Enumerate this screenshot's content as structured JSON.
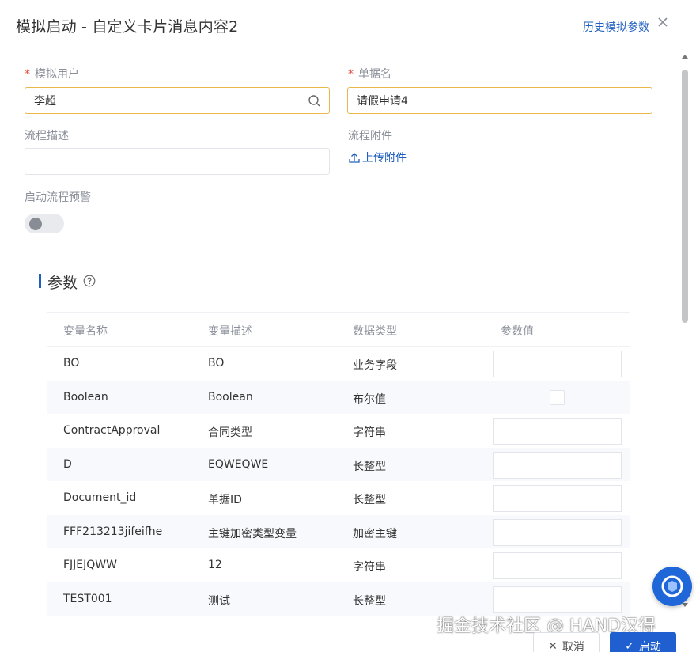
{
  "header": {
    "title": "模拟启动 - 自定义卡片消息内容2",
    "history_link": "历史模拟参数"
  },
  "form": {
    "user": {
      "label": "模拟用户",
      "value": "李超",
      "required": true
    },
    "doc_name": {
      "label": "单据名",
      "value": "请假申请4",
      "required": true
    },
    "flow_desc": {
      "label": "流程描述",
      "value": ""
    },
    "attachments": {
      "label": "流程附件",
      "upload_label": "上传附件"
    },
    "warning": {
      "label": "启动流程预警",
      "enabled": false
    }
  },
  "params": {
    "title": "参数",
    "columns": [
      "变量名称",
      "变量描述",
      "数据类型",
      "参数值"
    ],
    "rows": [
      {
        "name": "BO",
        "desc": "BO",
        "type": "业务字段",
        "input": "text"
      },
      {
        "name": "Boolean",
        "desc": "Boolean",
        "type": "布尔值",
        "input": "checkbox"
      },
      {
        "name": "ContractApproval",
        "desc": "合同类型",
        "type": "字符串",
        "input": "text"
      },
      {
        "name": "D",
        "desc": "EQWEQWE",
        "type": "长整型",
        "input": "text"
      },
      {
        "name": "Document_id",
        "desc": "单据ID",
        "type": "长整型",
        "input": "text"
      },
      {
        "name": "FFF213213jifeifhe",
        "desc": "主键加密类型变量",
        "type": "加密主键",
        "input": "text"
      },
      {
        "name": "FJJEJQWW",
        "desc": "12",
        "type": "字符串",
        "input": "text"
      },
      {
        "name": "TEST001",
        "desc": "测试",
        "type": "长整型",
        "input": "text"
      }
    ]
  },
  "footer": {
    "cancel_label": "取消",
    "start_label": "启动"
  },
  "watermark": "掘金技术社区 @ HAND汉得",
  "icons": {
    "close": "close-icon",
    "search": "search-icon",
    "upload": "upload-icon",
    "help": "help-circle-icon",
    "assistant": "assistant-icon"
  },
  "colors": {
    "accent": "#1f5fbf",
    "focus_border": "#e8b84b",
    "required": "#e74c3c",
    "primary_button": "#1f5fd0"
  }
}
